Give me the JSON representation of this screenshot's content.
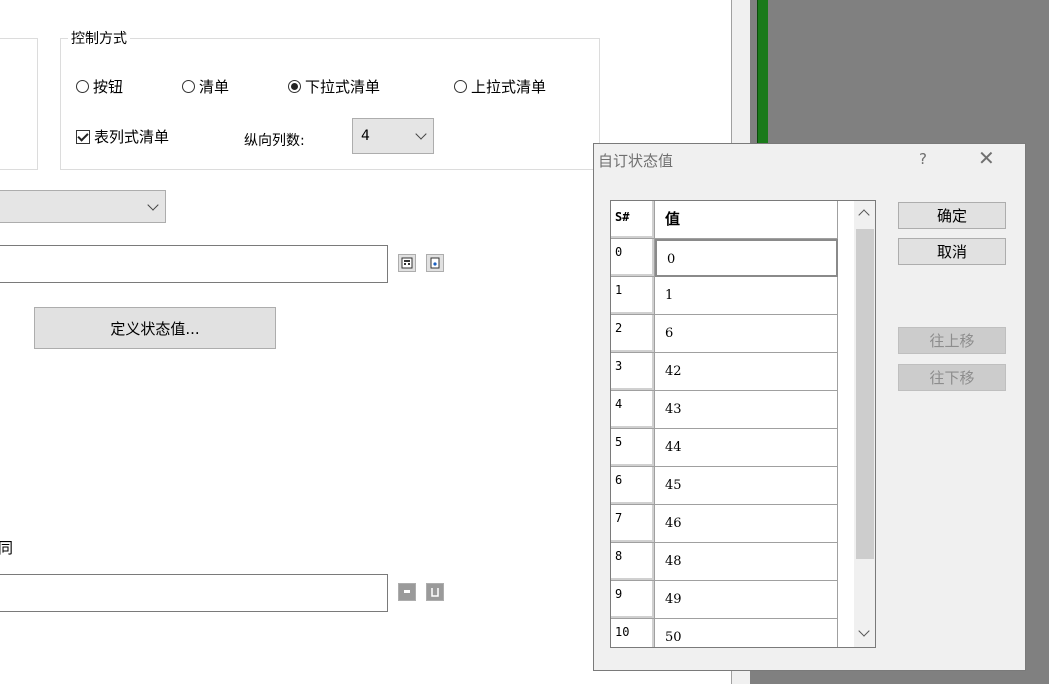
{
  "control_mode": {
    "legend": "控制方式",
    "options": [
      "按钮",
      "清单",
      "下拉式清单",
      "上拉式清单"
    ],
    "selected": "下拉式清单",
    "tabular_list_label": "表列式清单",
    "tabular_checked": true,
    "columns_label": "纵向列数:",
    "columns_value": "4"
  },
  "define_states_button": "定义状态值...",
  "partial_label": "同",
  "dialog": {
    "title": "自订状态值",
    "help": "?",
    "close": "✕",
    "col_index": "S#",
    "col_value": "值",
    "rows": [
      {
        "index": "0",
        "value": "0"
      },
      {
        "index": "1",
        "value": "1"
      },
      {
        "index": "2",
        "value": "6"
      },
      {
        "index": "3",
        "value": "42"
      },
      {
        "index": "4",
        "value": "43"
      },
      {
        "index": "5",
        "value": "44"
      },
      {
        "index": "6",
        "value": "45"
      },
      {
        "index": "7",
        "value": "46"
      },
      {
        "index": "8",
        "value": "48"
      },
      {
        "index": "9",
        "value": "49"
      },
      {
        "index": "10",
        "value": "50"
      }
    ],
    "ok": "确定",
    "cancel": "取消",
    "move_up": "往上移",
    "move_down": "往下移"
  },
  "colors": {
    "window_bg": "#f0f0f0",
    "desktop_bg": "#808080",
    "accent_green": "#1a7a1a"
  }
}
